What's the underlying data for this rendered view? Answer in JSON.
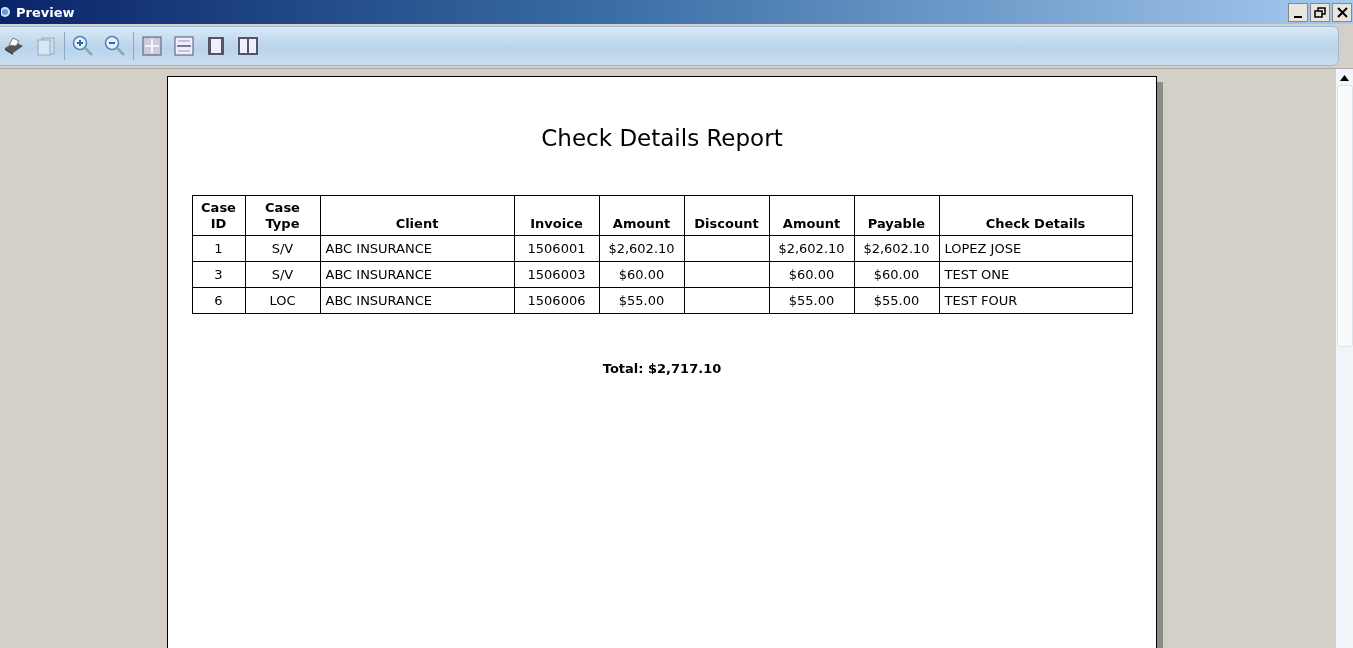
{
  "window": {
    "title": "Preview"
  },
  "report": {
    "title": "Check Details Report",
    "columns": [
      "Case ID",
      "Case Type",
      "Client",
      "Invoice",
      "Amount",
      "Discount",
      "Amount",
      "Payable",
      "Check Details"
    ],
    "rows": [
      [
        "1",
        "S/V",
        "ABC INSURANCE",
        "1506001",
        "$2,602.10",
        "",
        "$2,602.10",
        "$2,602.10",
        "LOPEZ JOSE"
      ],
      [
        "3",
        "S/V",
        "ABC INSURANCE",
        "1506003",
        "$60.00",
        "",
        "$60.00",
        "$60.00",
        "TEST ONE"
      ],
      [
        "6",
        "LOC",
        "ABC INSURANCE",
        "1506006",
        "$55.00",
        "",
        "$55.00",
        "$55.00",
        "TEST FOUR"
      ]
    ],
    "total": "Total: $2,717.10"
  }
}
